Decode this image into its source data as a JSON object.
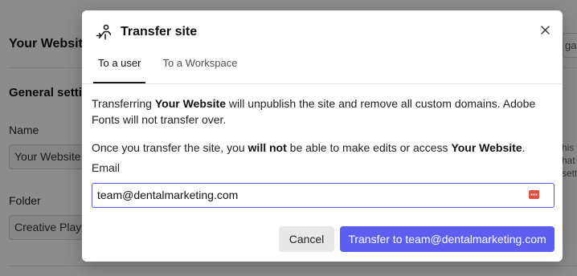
{
  "background": {
    "title": "Your Website",
    "section": "General setti",
    "name_label": "Name",
    "name_value": "Your Website",
    "folder_label": "Folder",
    "folder_value": "Creative Playg",
    "right_field": "ga",
    "right_text_1": "his",
    "right_text_2": "hat",
    "right_text_3": "setti"
  },
  "modal": {
    "title": "Transfer site",
    "tabs": [
      {
        "label": "To a user",
        "active": true
      },
      {
        "label": "To a Workspace",
        "active": false
      }
    ],
    "paragraph1": {
      "pre": "Transferring ",
      "bold": "Your Website",
      "post": " will unpublish the site and remove all custom domains. Adobe Fonts will not transfer over."
    },
    "paragraph2": {
      "pre": "Once you transfer the site, you ",
      "bold1": "will not",
      "mid": " be able to make edits or access ",
      "bold2": "Your Website",
      "post": "."
    },
    "email_label": "Email",
    "email_value": "team@dentalmarketing.com",
    "cancel_label": "Cancel",
    "transfer_label": "Transfer to team@dentalmarketing.com"
  },
  "icons": {
    "header": "transfer-user-icon",
    "close": "close-icon",
    "password_manager": "password-manager-icon"
  },
  "colors": {
    "accent": "#5b5ef0",
    "input_focus": "#5258e4",
    "password_icon": "#e3503e"
  }
}
